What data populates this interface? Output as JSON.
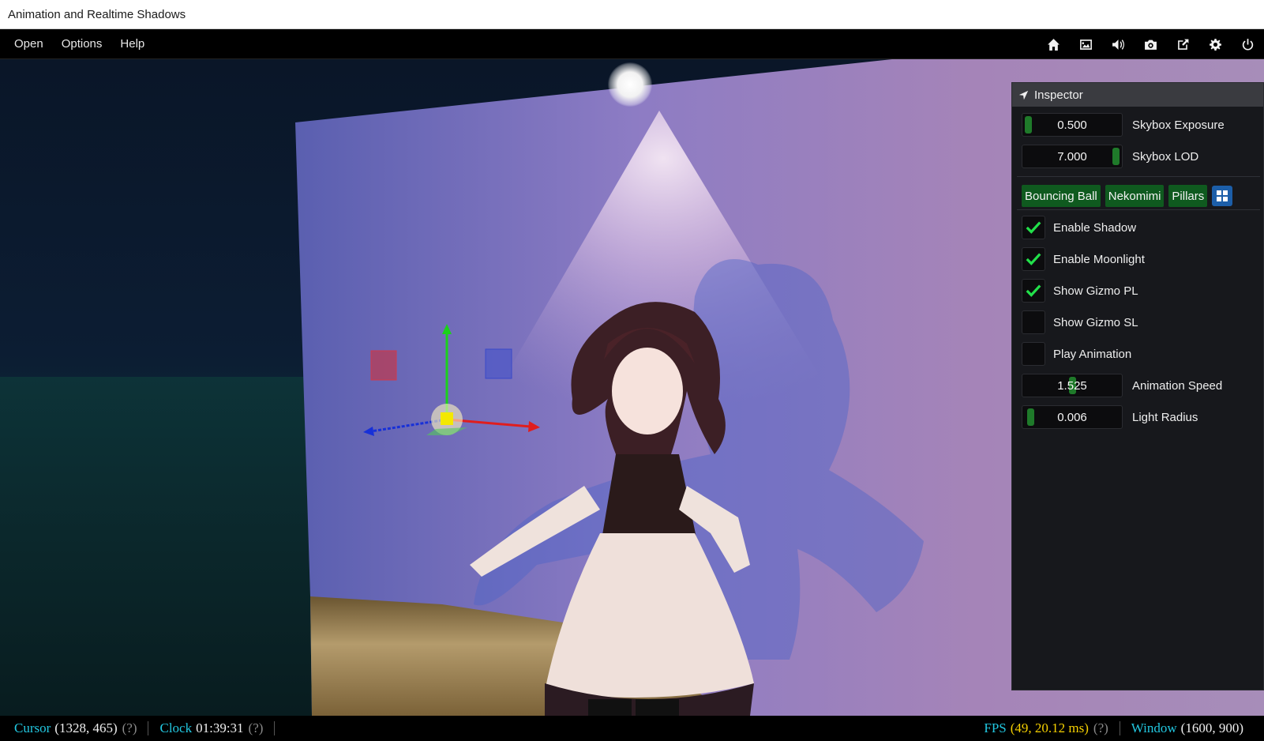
{
  "window": {
    "title": "Animation and Realtime Shadows"
  },
  "menu": {
    "items": [
      "Open",
      "Options",
      "Help"
    ]
  },
  "toolbar": {
    "icons": [
      "home-icon",
      "image-icon",
      "volume-icon",
      "camera-icon",
      "external-link-icon",
      "settings-icon",
      "power-icon"
    ]
  },
  "inspector": {
    "title": "Inspector",
    "sliders_top": [
      {
        "value": "0.500",
        "label": "Skybox Exposure",
        "fraction": 0.0
      },
      {
        "value": "7.000",
        "label": "Skybox LOD",
        "fraction": 1.0
      }
    ],
    "tabs": [
      "Bouncing Ball",
      "Nekomimi",
      "Pillars"
    ],
    "checkboxes": [
      {
        "label": "Enable Shadow",
        "checked": true
      },
      {
        "label": "Enable Moonlight",
        "checked": true
      },
      {
        "label": "Show Gizmo PL",
        "checked": true
      },
      {
        "label": "Show Gizmo SL",
        "checked": false
      },
      {
        "label": "Play Animation",
        "checked": false
      }
    ],
    "sliders_bottom": [
      {
        "value": "1.525",
        "label": "Animation Speed",
        "fraction": 0.5
      },
      {
        "value": "0.006",
        "label": "Light Radius",
        "fraction": 0.03
      }
    ]
  },
  "status": {
    "cursor_label": "Cursor",
    "cursor_value": "(1328, 465)",
    "cursor_help": "(?)",
    "clock_label": "Clock",
    "clock_value": "01:39:31",
    "clock_help": "(?)",
    "fps_label": "FPS",
    "fps_value": "(49, 20.12 ms)",
    "fps_help": "(?)",
    "window_label": "Window",
    "window_value": "(1600, 900)"
  },
  "colors": {
    "accent_green": "#0f5a1f",
    "check_green": "#22e04a",
    "status_cyan": "#22c7e0",
    "fps_yellow": "#f5d000"
  }
}
